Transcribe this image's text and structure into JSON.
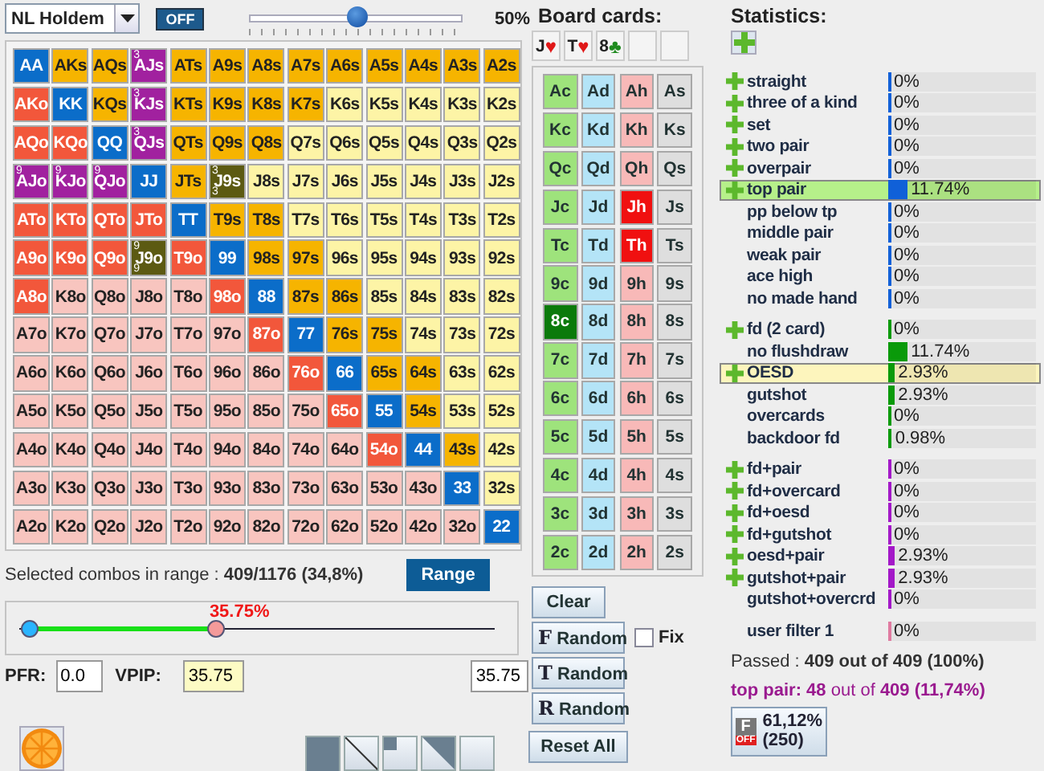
{
  "game_select": {
    "value": "NL Holdem"
  },
  "toggle": {
    "label": "OFF",
    "on": false
  },
  "weight_slider": {
    "level": 0.5,
    "reading": "50%"
  },
  "hand_grid": [
    [
      {
        "label": "AA",
        "kind": "pair"
      },
      {
        "label": "AKs",
        "kind": "suited"
      },
      {
        "label": "AQs",
        "kind": "suited"
      },
      {
        "label": "AJs",
        "kind": "made",
        "top_note": "3"
      },
      {
        "label": "ATs",
        "kind": "suited"
      },
      {
        "label": "A9s",
        "kind": "suited"
      },
      {
        "label": "A8s",
        "kind": "suited"
      },
      {
        "label": "A7s",
        "kind": "suited"
      },
      {
        "label": "A6s",
        "kind": "suited"
      },
      {
        "label": "A5s",
        "kind": "suited"
      },
      {
        "label": "A4s",
        "kind": "suited"
      },
      {
        "label": "A3s",
        "kind": "suited"
      },
      {
        "label": "A2s",
        "kind": "suited"
      }
    ],
    [
      {
        "label": "AKo",
        "kind": "offsuit"
      },
      {
        "label": "KK",
        "kind": "pair"
      },
      {
        "label": "KQs",
        "kind": "suited"
      },
      {
        "label": "KJs",
        "kind": "made",
        "top_note": "3"
      },
      {
        "label": "KTs",
        "kind": "suited"
      },
      {
        "label": "K9s",
        "kind": "suited"
      },
      {
        "label": "K8s",
        "kind": "suited"
      },
      {
        "label": "K7s",
        "kind": "suited"
      },
      {
        "label": "K6s",
        "kind": "suited-out"
      },
      {
        "label": "K5s",
        "kind": "suited-out"
      },
      {
        "label": "K4s",
        "kind": "suited-out"
      },
      {
        "label": "K3s",
        "kind": "suited-out"
      },
      {
        "label": "K2s",
        "kind": "suited-out"
      }
    ],
    [
      {
        "label": "AQo",
        "kind": "offsuit"
      },
      {
        "label": "KQo",
        "kind": "offsuit"
      },
      {
        "label": "QQ",
        "kind": "pair"
      },
      {
        "label": "QJs",
        "kind": "made",
        "top_note": "3"
      },
      {
        "label": "QTs",
        "kind": "suited"
      },
      {
        "label": "Q9s",
        "kind": "suited"
      },
      {
        "label": "Q8s",
        "kind": "suited"
      },
      {
        "label": "Q7s",
        "kind": "suited-out"
      },
      {
        "label": "Q6s",
        "kind": "suited-out"
      },
      {
        "label": "Q5s",
        "kind": "suited-out"
      },
      {
        "label": "Q4s",
        "kind": "suited-out"
      },
      {
        "label": "Q3s",
        "kind": "suited-out"
      },
      {
        "label": "Q2s",
        "kind": "suited-out"
      }
    ],
    [
      {
        "label": "AJo",
        "kind": "made",
        "top_note": "9"
      },
      {
        "label": "KJo",
        "kind": "made",
        "top_note": "9"
      },
      {
        "label": "QJo",
        "kind": "made",
        "top_note": "9"
      },
      {
        "label": "JJ",
        "kind": "pair"
      },
      {
        "label": "JTs",
        "kind": "suited"
      },
      {
        "label": "J9s",
        "kind": "draw",
        "top_note": "3",
        "bottom_note": "3"
      },
      {
        "label": "J8s",
        "kind": "suited-out"
      },
      {
        "label": "J7s",
        "kind": "suited-out"
      },
      {
        "label": "J6s",
        "kind": "suited-out"
      },
      {
        "label": "J5s",
        "kind": "suited-out"
      },
      {
        "label": "J4s",
        "kind": "suited-out"
      },
      {
        "label": "J3s",
        "kind": "suited-out"
      },
      {
        "label": "J2s",
        "kind": "suited-out"
      }
    ],
    [
      {
        "label": "ATo",
        "kind": "offsuit"
      },
      {
        "label": "KTo",
        "kind": "offsuit"
      },
      {
        "label": "QTo",
        "kind": "offsuit"
      },
      {
        "label": "JTo",
        "kind": "offsuit"
      },
      {
        "label": "TT",
        "kind": "pair"
      },
      {
        "label": "T9s",
        "kind": "suited"
      },
      {
        "label": "T8s",
        "kind": "suited"
      },
      {
        "label": "T7s",
        "kind": "suited-out"
      },
      {
        "label": "T6s",
        "kind": "suited-out"
      },
      {
        "label": "T5s",
        "kind": "suited-out"
      },
      {
        "label": "T4s",
        "kind": "suited-out"
      },
      {
        "label": "T3s",
        "kind": "suited-out"
      },
      {
        "label": "T2s",
        "kind": "suited-out"
      }
    ],
    [
      {
        "label": "A9o",
        "kind": "offsuit"
      },
      {
        "label": "K9o",
        "kind": "offsuit"
      },
      {
        "label": "Q9o",
        "kind": "offsuit"
      },
      {
        "label": "J9o",
        "kind": "draw",
        "top_note": "9",
        "bottom_note": "9"
      },
      {
        "label": "T9o",
        "kind": "offsuit"
      },
      {
        "label": "99",
        "kind": "pair"
      },
      {
        "label": "98s",
        "kind": "suited"
      },
      {
        "label": "97s",
        "kind": "suited"
      },
      {
        "label": "96s",
        "kind": "suited-out"
      },
      {
        "label": "95s",
        "kind": "suited-out"
      },
      {
        "label": "94s",
        "kind": "suited-out"
      },
      {
        "label": "93s",
        "kind": "suited-out"
      },
      {
        "label": "92s",
        "kind": "suited-out"
      }
    ],
    [
      {
        "label": "A8o",
        "kind": "offsuit"
      },
      {
        "label": "K8o",
        "kind": "offsuit-out"
      },
      {
        "label": "Q8o",
        "kind": "offsuit-out"
      },
      {
        "label": "J8o",
        "kind": "offsuit-out"
      },
      {
        "label": "T8o",
        "kind": "offsuit-out"
      },
      {
        "label": "98o",
        "kind": "offsuit"
      },
      {
        "label": "88",
        "kind": "pair"
      },
      {
        "label": "87s",
        "kind": "suited"
      },
      {
        "label": "86s",
        "kind": "suited"
      },
      {
        "label": "85s",
        "kind": "suited-out"
      },
      {
        "label": "84s",
        "kind": "suited-out"
      },
      {
        "label": "83s",
        "kind": "suited-out"
      },
      {
        "label": "82s",
        "kind": "suited-out"
      }
    ],
    [
      {
        "label": "A7o",
        "kind": "offsuit-out"
      },
      {
        "label": "K7o",
        "kind": "offsuit-out"
      },
      {
        "label": "Q7o",
        "kind": "offsuit-out"
      },
      {
        "label": "J7o",
        "kind": "offsuit-out"
      },
      {
        "label": "T7o",
        "kind": "offsuit-out"
      },
      {
        "label": "97o",
        "kind": "offsuit-out"
      },
      {
        "label": "87o",
        "kind": "offsuit"
      },
      {
        "label": "77",
        "kind": "pair"
      },
      {
        "label": "76s",
        "kind": "suited"
      },
      {
        "label": "75s",
        "kind": "suited"
      },
      {
        "label": "74s",
        "kind": "suited-out"
      },
      {
        "label": "73s",
        "kind": "suited-out"
      },
      {
        "label": "72s",
        "kind": "suited-out"
      }
    ],
    [
      {
        "label": "A6o",
        "kind": "offsuit-out"
      },
      {
        "label": "K6o",
        "kind": "offsuit-out"
      },
      {
        "label": "Q6o",
        "kind": "offsuit-out"
      },
      {
        "label": "J6o",
        "kind": "offsuit-out"
      },
      {
        "label": "T6o",
        "kind": "offsuit-out"
      },
      {
        "label": "96o",
        "kind": "offsuit-out"
      },
      {
        "label": "86o",
        "kind": "offsuit-out"
      },
      {
        "label": "76o",
        "kind": "offsuit"
      },
      {
        "label": "66",
        "kind": "pair"
      },
      {
        "label": "65s",
        "kind": "suited"
      },
      {
        "label": "64s",
        "kind": "suited"
      },
      {
        "label": "63s",
        "kind": "suited-out"
      },
      {
        "label": "62s",
        "kind": "suited-out"
      }
    ],
    [
      {
        "label": "A5o",
        "kind": "offsuit-out"
      },
      {
        "label": "K5o",
        "kind": "offsuit-out"
      },
      {
        "label": "Q5o",
        "kind": "offsuit-out"
      },
      {
        "label": "J5o",
        "kind": "offsuit-out"
      },
      {
        "label": "T5o",
        "kind": "offsuit-out"
      },
      {
        "label": "95o",
        "kind": "offsuit-out"
      },
      {
        "label": "85o",
        "kind": "offsuit-out"
      },
      {
        "label": "75o",
        "kind": "offsuit-out"
      },
      {
        "label": "65o",
        "kind": "offsuit"
      },
      {
        "label": "55",
        "kind": "pair"
      },
      {
        "label": "54s",
        "kind": "suited"
      },
      {
        "label": "53s",
        "kind": "suited-out"
      },
      {
        "label": "52s",
        "kind": "suited-out"
      }
    ],
    [
      {
        "label": "A4o",
        "kind": "offsuit-out"
      },
      {
        "label": "K4o",
        "kind": "offsuit-out"
      },
      {
        "label": "Q4o",
        "kind": "offsuit-out"
      },
      {
        "label": "J4o",
        "kind": "offsuit-out"
      },
      {
        "label": "T4o",
        "kind": "offsuit-out"
      },
      {
        "label": "94o",
        "kind": "offsuit-out"
      },
      {
        "label": "84o",
        "kind": "offsuit-out"
      },
      {
        "label": "74o",
        "kind": "offsuit-out"
      },
      {
        "label": "64o",
        "kind": "offsuit-out"
      },
      {
        "label": "54o",
        "kind": "offsuit"
      },
      {
        "label": "44",
        "kind": "pair"
      },
      {
        "label": "43s",
        "kind": "suited"
      },
      {
        "label": "42s",
        "kind": "suited-out"
      }
    ],
    [
      {
        "label": "A3o",
        "kind": "offsuit-out"
      },
      {
        "label": "K3o",
        "kind": "offsuit-out"
      },
      {
        "label": "Q3o",
        "kind": "offsuit-out"
      },
      {
        "label": "J3o",
        "kind": "offsuit-out"
      },
      {
        "label": "T3o",
        "kind": "offsuit-out"
      },
      {
        "label": "93o",
        "kind": "offsuit-out"
      },
      {
        "label": "83o",
        "kind": "offsuit-out"
      },
      {
        "label": "73o",
        "kind": "offsuit-out"
      },
      {
        "label": "63o",
        "kind": "offsuit-out"
      },
      {
        "label": "53o",
        "kind": "offsuit-out"
      },
      {
        "label": "43o",
        "kind": "offsuit-out"
      },
      {
        "label": "33",
        "kind": "pair"
      },
      {
        "label": "32s",
        "kind": "suited-out"
      }
    ],
    [
      {
        "label": "A2o",
        "kind": "offsuit-out"
      },
      {
        "label": "K2o",
        "kind": "offsuit-out"
      },
      {
        "label": "Q2o",
        "kind": "offsuit-out"
      },
      {
        "label": "J2o",
        "kind": "offsuit-out"
      },
      {
        "label": "T2o",
        "kind": "offsuit-out"
      },
      {
        "label": "92o",
        "kind": "offsuit-out"
      },
      {
        "label": "82o",
        "kind": "offsuit-out"
      },
      {
        "label": "72o",
        "kind": "offsuit-out"
      },
      {
        "label": "62o",
        "kind": "offsuit-out"
      },
      {
        "label": "52o",
        "kind": "offsuit-out"
      },
      {
        "label": "42o",
        "kind": "offsuit-out"
      },
      {
        "label": "32o",
        "kind": "offsuit-out"
      },
      {
        "label": "22",
        "kind": "pair"
      }
    ]
  ],
  "combos_text": "Selected combos in range : **409/1176 (34,8%)**",
  "range_button": "Range",
  "range_slider": {
    "level": 0.41,
    "reading": "35.75%"
  },
  "pfr": {
    "label": "PFR:",
    "value": "0.0"
  },
  "vpip": {
    "label": "VPIP:",
    "value": "35.75",
    "focused": true
  },
  "range_value": "35.75",
  "shape_buttons": [
    {
      "kind": "filled"
    },
    {
      "kind": "diagonal"
    },
    {
      "kind": "corner"
    },
    {
      "kind": "triangle"
    },
    {
      "kind": "blank"
    }
  ],
  "board": {
    "title": "Board cards:",
    "slots": [
      {
        "kind": "card",
        "rank": "J",
        "symbol": "♥",
        "color": "#e01818"
      },
      {
        "kind": "card",
        "rank": "T",
        "symbol": "♥",
        "color": "#e01818"
      },
      {
        "kind": "card",
        "rank": "8",
        "symbol": "♣",
        "color": "#1f8a1f"
      },
      {
        "kind": "empty"
      },
      {
        "kind": "empty"
      }
    ],
    "cards": [
      [
        {
          "label": "Ac",
          "kind": "club",
          "selected": false
        },
        {
          "label": "Ad",
          "kind": "diamond",
          "selected": false
        },
        {
          "label": "Ah",
          "kind": "heart",
          "selected": false
        },
        {
          "label": "As",
          "kind": "spade",
          "selected": false
        }
      ],
      [
        {
          "label": "Kc",
          "kind": "club",
          "selected": false
        },
        {
          "label": "Kd",
          "kind": "diamond",
          "selected": false
        },
        {
          "label": "Kh",
          "kind": "heart",
          "selected": false
        },
        {
          "label": "Ks",
          "kind": "spade",
          "selected": false
        }
      ],
      [
        {
          "label": "Qc",
          "kind": "club",
          "selected": false
        },
        {
          "label": "Qd",
          "kind": "diamond",
          "selected": false
        },
        {
          "label": "Qh",
          "kind": "heart",
          "selected": false
        },
        {
          "label": "Qs",
          "kind": "spade",
          "selected": false
        }
      ],
      [
        {
          "label": "Jc",
          "kind": "club",
          "selected": false
        },
        {
          "label": "Jd",
          "kind": "diamond",
          "selected": false
        },
        {
          "label": "Jh",
          "kind": "heart",
          "selected": true
        },
        {
          "label": "Js",
          "kind": "spade",
          "selected": false
        }
      ],
      [
        {
          "label": "Tc",
          "kind": "club",
          "selected": false
        },
        {
          "label": "Td",
          "kind": "diamond",
          "selected": false
        },
        {
          "label": "Th",
          "kind": "heart",
          "selected": true
        },
        {
          "label": "Ts",
          "kind": "spade",
          "selected": false
        }
      ],
      [
        {
          "label": "9c",
          "kind": "club",
          "selected": false
        },
        {
          "label": "9d",
          "kind": "diamond",
          "selected": false
        },
        {
          "label": "9h",
          "kind": "heart",
          "selected": false
        },
        {
          "label": "9s",
          "kind": "spade",
          "selected": false
        }
      ],
      [
        {
          "label": "8c",
          "kind": "club",
          "selected": true
        },
        {
          "label": "8d",
          "kind": "diamond",
          "selected": false
        },
        {
          "label": "8h",
          "kind": "heart",
          "selected": false
        },
        {
          "label": "8s",
          "kind": "spade",
          "selected": false
        }
      ],
      [
        {
          "label": "7c",
          "kind": "club",
          "selected": false
        },
        {
          "label": "7d",
          "kind": "diamond",
          "selected": false
        },
        {
          "label": "7h",
          "kind": "heart",
          "selected": false
        },
        {
          "label": "7s",
          "kind": "spade",
          "selected": false
        }
      ],
      [
        {
          "label": "6c",
          "kind": "club",
          "selected": false
        },
        {
          "label": "6d",
          "kind": "diamond",
          "selected": false
        },
        {
          "label": "6h",
          "kind": "heart",
          "selected": false
        },
        {
          "label": "6s",
          "kind": "spade",
          "selected": false
        }
      ],
      [
        {
          "label": "5c",
          "kind": "club",
          "selected": false
        },
        {
          "label": "5d",
          "kind": "diamond",
          "selected": false
        },
        {
          "label": "5h",
          "kind": "heart",
          "selected": false
        },
        {
          "label": "5s",
          "kind": "spade",
          "selected": false
        }
      ],
      [
        {
          "label": "4c",
          "kind": "club",
          "selected": false
        },
        {
          "label": "4d",
          "kind": "diamond",
          "selected": false
        },
        {
          "label": "4h",
          "kind": "heart",
          "selected": false
        },
        {
          "label": "4s",
          "kind": "spade",
          "selected": false
        }
      ],
      [
        {
          "label": "3c",
          "kind": "club",
          "selected": false
        },
        {
          "label": "3d",
          "kind": "diamond",
          "selected": false
        },
        {
          "label": "3h",
          "kind": "heart",
          "selected": false
        },
        {
          "label": "3s",
          "kind": "spade",
          "selected": false
        }
      ],
      [
        {
          "label": "2c",
          "kind": "club",
          "selected": false
        },
        {
          "label": "2d",
          "kind": "diamond",
          "selected": false
        },
        {
          "label": "2h",
          "kind": "heart",
          "selected": false
        },
        {
          "label": "2s",
          "kind": "spade",
          "selected": false
        }
      ]
    ]
  },
  "board_buttons": {
    "clear": "Clear",
    "random": [
      {
        "letter": "F",
        "label": "Random"
      },
      {
        "letter": "T",
        "label": "Random"
      },
      {
        "letter": "R",
        "label": "Random"
      }
    ],
    "fix": {
      "label": "Fix",
      "checked": false
    },
    "reset": "Reset All"
  },
  "statistics": {
    "title": "Statistics:",
    "groups": [
      {
        "kind": "made",
        "items": [
          {
            "label": "straight",
            "plus": true,
            "value": "0%",
            "level": 0,
            "selected": false
          },
          {
            "label": "three of a kind",
            "plus": true,
            "value": "0%",
            "level": 0,
            "selected": false
          },
          {
            "label": "set",
            "plus": true,
            "value": "0%",
            "level": 0,
            "selected": false
          },
          {
            "label": "two pair",
            "plus": true,
            "value": "0%",
            "level": 0,
            "selected": false
          },
          {
            "label": "overpair",
            "plus": true,
            "value": "0%",
            "level": 0,
            "selected": false
          },
          {
            "label": "top pair",
            "plus": true,
            "value": "11.74%",
            "level": 0.1174,
            "selected": true
          },
          {
            "label": "pp below tp",
            "plus": false,
            "value": "0%",
            "level": 0,
            "selected": false
          },
          {
            "label": "middle pair",
            "plus": false,
            "value": "0%",
            "level": 0,
            "selected": false
          },
          {
            "label": "weak pair",
            "plus": false,
            "value": "0%",
            "level": 0,
            "selected": false
          },
          {
            "label": "ace high",
            "plus": false,
            "value": "0%",
            "level": 0,
            "selected": false
          },
          {
            "label": "no made hand",
            "plus": false,
            "value": "0%",
            "level": 0,
            "selected": false
          }
        ]
      },
      {
        "kind": "draw",
        "items": [
          {
            "label": "fd (2 card)",
            "plus": true,
            "value": "0%",
            "level": 0,
            "selected": false
          },
          {
            "label": "no flushdraw",
            "plus": false,
            "value": "11.74%",
            "level": 0.1174,
            "selected": false
          },
          {
            "label": "OESD",
            "plus": true,
            "value": "2.93%",
            "level": 0.0293,
            "selected": true
          },
          {
            "label": "gutshot",
            "plus": false,
            "value": "2.93%",
            "level": 0.0293,
            "selected": false
          },
          {
            "label": "overcards",
            "plus": false,
            "value": "0%",
            "level": 0,
            "selected": false
          },
          {
            "label": "backdoor fd",
            "plus": false,
            "value": "0.98%",
            "level": 0.0098,
            "selected": false
          }
        ]
      },
      {
        "kind": "combo",
        "items": [
          {
            "label": "fd+pair",
            "plus": true,
            "value": "0%",
            "level": 0,
            "selected": false
          },
          {
            "label": "fd+overcard",
            "plus": true,
            "value": "0%",
            "level": 0,
            "selected": false
          },
          {
            "label": "fd+oesd",
            "plus": true,
            "value": "0%",
            "level": 0,
            "selected": false
          },
          {
            "label": "fd+gutshot",
            "plus": true,
            "value": "0%",
            "level": 0,
            "selected": false
          },
          {
            "label": "oesd+pair",
            "plus": true,
            "value": "2.93%",
            "level": 0.0293,
            "selected": false
          },
          {
            "label": "gutshot+pair",
            "plus": true,
            "value": "2.93%",
            "level": 0.0293,
            "selected": false
          },
          {
            "label": "gutshot+overcrd",
            "plus": false,
            "value": "0%",
            "level": 0,
            "selected": false
          }
        ]
      },
      {
        "kind": "user",
        "items": [
          {
            "label": "user filter 1",
            "plus": false,
            "value": "0%",
            "level": 0,
            "selected": false
          }
        ]
      }
    ],
    "passed": "Passed : **409 out of 409 (100%)**",
    "top_pair": "**top pair: 48** out of **409 (11,74%)**",
    "filter_button": {
      "letter": "F",
      "state": "OFF",
      "percent": "61,12%",
      "count": "(250)"
    }
  }
}
